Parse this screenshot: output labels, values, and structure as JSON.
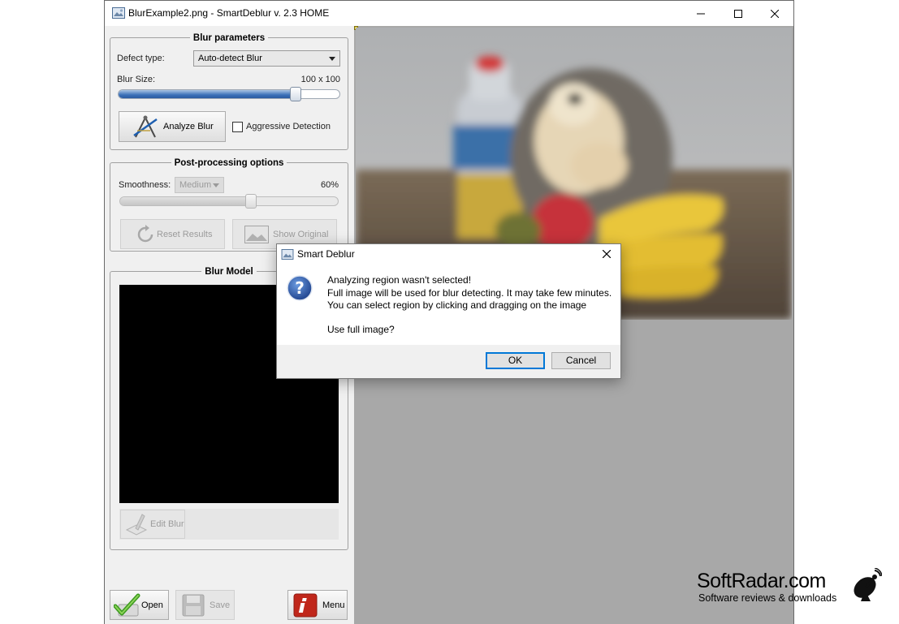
{
  "window": {
    "title": "BlurExample2.png - SmartDeblur v. 2.3 HOME"
  },
  "blur_params": {
    "heading": "Blur parameters",
    "defect_label": "Defect type:",
    "defect_value": "Auto-detect Blur",
    "size_label": "Blur Size:",
    "size_value": "100 x 100",
    "size_fraction": 0.8,
    "analyze_label": "Analyze Blur",
    "aggressive_label": "Aggressive Detection",
    "aggressive_checked": false
  },
  "post": {
    "heading": "Post-processing options",
    "smooth_label": "Smoothness:",
    "smooth_value": "Medium",
    "smooth_percent": "60%",
    "smooth_fraction": 0.6,
    "reset_label": "Reset Results",
    "show_label": "Show Original"
  },
  "model": {
    "heading": "Blur Model",
    "edit_label": "Edit Blur"
  },
  "bottom": {
    "open_label": "Open",
    "save_label": "Save",
    "menu_label": "Menu"
  },
  "dialog": {
    "title": "Smart Deblur",
    "line1": "Analyzing region wasn't selected!",
    "line2": "Full image will be used for blur detecting. It may take few minutes.",
    "line3": "You can select region by clicking and dragging on the image",
    "question": "Use full image?",
    "ok_label": "OK",
    "cancel_label": "Cancel"
  },
  "watermark": {
    "brand": "SoftRadar.com",
    "tagline": "Software reviews & downloads"
  },
  "colors": {
    "accent": "#0078d7",
    "slider_fill": "#3b70b8",
    "canvas_bg": "#a8a8a8",
    "menu_red": "#c0271b"
  }
}
